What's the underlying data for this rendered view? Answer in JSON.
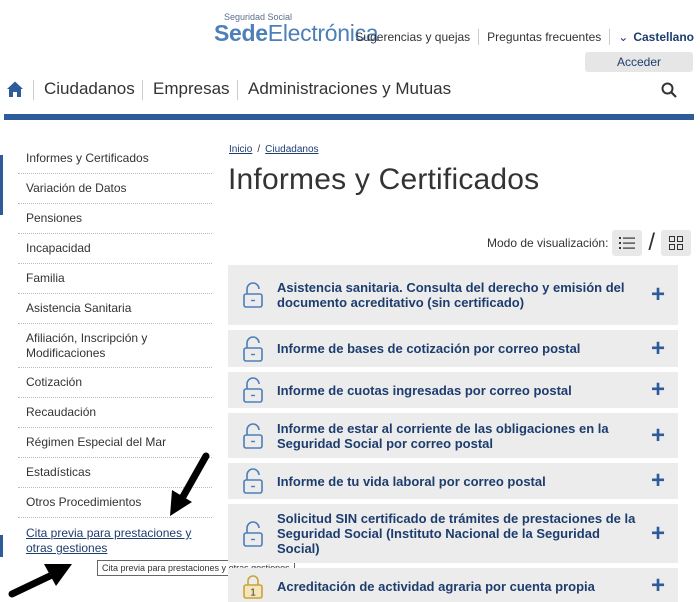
{
  "header": {
    "logo_small": "Seguridad Social",
    "logo_sede": "Sede",
    "logo_electronica": "Electrónica",
    "links": [
      "Sugerencias y quejas",
      "Preguntas frecuentes"
    ],
    "language": "Castellano",
    "login_label": "Acceder"
  },
  "nav": {
    "items": [
      "Ciudadanos",
      "Empresas",
      "Administraciones y Mutuas"
    ]
  },
  "sidebar": {
    "items": [
      "Informes y Certificados",
      "Variación de Datos",
      "Pensiones",
      "Incapacidad",
      "Familia",
      "Asistencia Sanitaria",
      "Afiliación, Inscripción y Modificaciones",
      "Cotización",
      "Recaudación",
      "Régimen Especial del Mar",
      "Estadísticas",
      "Otros Procedimientos",
      "Cita previa para prestaciones y otras gestiones"
    ],
    "tooltip": "Cita previa para prestaciones y otras gestiones"
  },
  "breadcrumb": {
    "items": [
      "Inicio",
      "Ciudadanos"
    ]
  },
  "page": {
    "title": "Informes y Certificados",
    "view_mode_label": "Modo de visualización:"
  },
  "procedures": [
    {
      "title": "Asistencia sanitaria. Consulta del derecho y emisión del documento acreditativo (sin certificado)",
      "icon": "unlock-icon"
    },
    {
      "title": "Informe de bases de cotización por correo postal",
      "icon": "unlock-icon"
    },
    {
      "title": "Informe de cuotas ingresadas por correo postal",
      "icon": "unlock-icon"
    },
    {
      "title": "Informe de estar al corriente de las obligaciones en la Seguridad Social por correo postal",
      "icon": "unlock-icon"
    },
    {
      "title": "Informe de tu vida laboral por correo postal",
      "icon": "unlock-icon"
    },
    {
      "title": "Solicitud SIN certificado de trámites de prestaciones de la Seguridad Social (Instituto Nacional de la Seguridad Social)",
      "icon": "unlock-icon"
    },
    {
      "title": "Acreditación de actividad agraria por cuenta propia",
      "icon": "lock-one-icon"
    }
  ],
  "colors": {
    "brand_blue": "#2e5c9a",
    "link_blue": "#1d3d6e",
    "logo_blue": "#4d7fb8",
    "item_background": "#ececec",
    "lock_level_one": "#c9a23a"
  }
}
